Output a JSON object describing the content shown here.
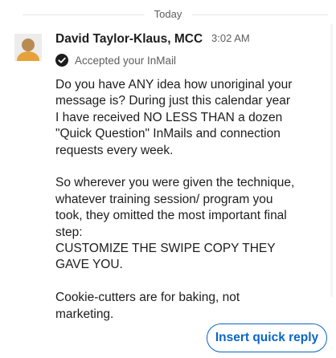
{
  "divider": {
    "label": "Today"
  },
  "message": {
    "sender_name": "David Taylor-Klaus, MCC",
    "timestamp": "3:02 AM",
    "status": "Accepted your InMail",
    "status_icon": "check-circle-icon",
    "avatar_icon": "person-avatar-icon",
    "paragraphs": [
      "Do you have ANY idea how unoriginal your message is? During just this calendar year I have received NO LESS THAN a dozen \"Quick Question\" InMails and connection requests every week.",
      "So wherever you were given the technique, whatever training session/ program you took, they omitted the most important final step:\nCUSTOMIZE THE SWIPE COPY THEY GAVE YOU.",
      "Cookie-cutters are for baking, not marketing."
    ]
  },
  "actions": {
    "insert_quick_reply": "Insert quick reply"
  },
  "colors": {
    "accent": "#0a66c2",
    "text_primary": "#1d1d1d",
    "text_secondary": "#5e5e5e"
  }
}
